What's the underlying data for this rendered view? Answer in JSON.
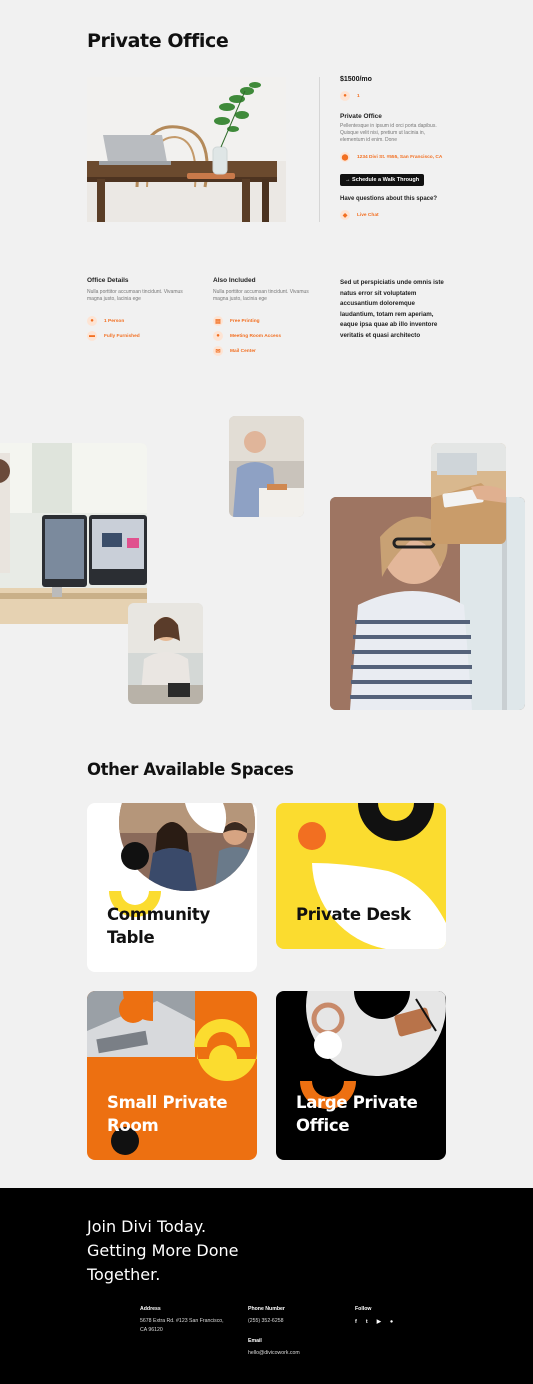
{
  "page_title": "Private Office",
  "listing": {
    "price": "$1500/mo",
    "capacity": "1",
    "name": "Private Office",
    "desc": "Pellentesque in ipsum id orci porta dapibus. Quisque velit nisi, pretium ut lacinia in, elementum id enim. Done",
    "address": "1234 Divi St. #555, San Francisco, CA",
    "schedule_button": "→ Schedule a Walk Through",
    "questions_label": "Have questions about this space?",
    "live_chat": "Live Chat"
  },
  "details": {
    "office_title": "Office Details",
    "office_text": "Nulla porttitor accumsan tincidunt. Vivamus magna justo, lacinia ege",
    "office_items": [
      "1 Person",
      "Fully Furnished"
    ],
    "included_title": "Also Included",
    "included_text": "Nulla porttitor accumsan tincidunt. Vivamus magna justo, lacinia ege",
    "included_items": [
      "Free Printing",
      "Meeting Room Access",
      "Mail Center"
    ],
    "quote": "Sed ut perspiciatis unde omnis iste natus error sit voluptatem accusantium doloremque laudantium, totam rem aperiam, eaque ipsa quae ab illo inventore veritatis et quasi architecto"
  },
  "other_spaces": {
    "heading": "Other Available Spaces",
    "cards": [
      {
        "label_line1": "Community",
        "label_line2": "Table"
      },
      {
        "label_line1": "Private Desk",
        "label_line2": ""
      },
      {
        "label_line1": "Small Private",
        "label_line2": "Room"
      },
      {
        "label_line1": "Large Private",
        "label_line2": "Office"
      }
    ]
  },
  "footer": {
    "tagline_line1": "Join Divi Today.",
    "tagline_line2": "Getting More Done",
    "tagline_line3": "Together.",
    "address_head": "Address",
    "address_line1": "5678 Extra Rd. #123 San Francisco,",
    "address_line2": "CA 96120",
    "phone_head": "Phone Number",
    "phone": "(255) 352-6258",
    "email_head": "Email",
    "email": "hello@divicowork.com",
    "follow_head": "Follow",
    "social_icons": [
      "facebook-icon",
      "twitter-icon",
      "youtube-icon",
      "apple-icon"
    ]
  },
  "colors": {
    "accent": "#f26f21",
    "yellow": "#fbdc2f",
    "orange_card": "#ed7011",
    "black": "#000000"
  }
}
